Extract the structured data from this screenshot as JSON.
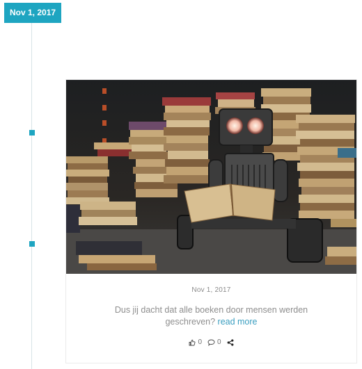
{
  "timeline": {
    "date_badge": "Nov 1, 2017"
  },
  "post": {
    "date": "Nov 1, 2017",
    "excerpt": "Dus jij dacht dat alle boeken door mensen werden geschreven?",
    "read_more": "read more",
    "likes": "0",
    "comments": "0",
    "image_alt_icon": "robot-reading-books-image"
  },
  "colors": {
    "accent": "#1ea5c1",
    "link": "#3a9ec0",
    "text_muted": "#8e8e8e"
  }
}
